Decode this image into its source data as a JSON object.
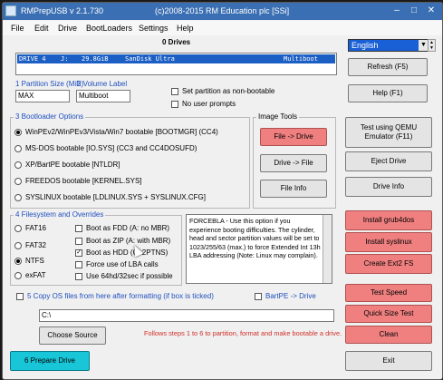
{
  "window": {
    "title": "RMPrepUSB v 2.1.730",
    "copyright": "(c)2008-2015 RM Education plc [SSi]",
    "controls": {
      "minimize": "–",
      "maximize": "□",
      "close": "✕"
    }
  },
  "menu": [
    "File",
    "Edit",
    "Drive",
    "BootLoaders",
    "Settings",
    "Help"
  ],
  "drives": {
    "title": "0 Drives",
    "row": {
      "drive": "DRIVE 4",
      "letter": "J:",
      "size": "29.8GiB",
      "name": "SanDisk Ultra",
      "type": "Multiboot"
    }
  },
  "language": {
    "selected": "English",
    "dropdown_icon": "▼"
  },
  "partition": {
    "size_label": "1 Partition Size (MiB)",
    "size_value": "MAX",
    "volume_label": "2 Volume Label",
    "volume_value": "Multiboot",
    "non_bootable": "Set partition as non-bootable",
    "no_prompts": "No user prompts"
  },
  "bootloader": {
    "title": "3 Bootloader Options",
    "options": [
      "WinPEv2/WinPEv3/Vista/Win7 bootable [BOOTMGR] (CC4)",
      "MS-DOS bootable [IO.SYS]   (CC3 and CC4DOSUFD)",
      "XP/BartPE bootable [NTLDR]",
      "FREEDOS bootable [KERNEL.SYS]",
      "SYSLINUX bootable [LDLINUX.SYS + SYSLINUX.CFG]"
    ]
  },
  "image_tools": {
    "title": "Image Tools",
    "file_to_drive": "File -> Drive",
    "drive_to_file": "Drive -> File",
    "file_info": "File Info"
  },
  "filesystem": {
    "title": "4 Filesystem and Overrides",
    "types": [
      "FAT16",
      "FAT32",
      "NTFS",
      "exFAT"
    ],
    "overrides": [
      "Boot as FDD (A: no MBR)",
      "Boot as ZIP (A: with MBR)",
      "Boot as HDD (C: 2PTNS)",
      "Force use of LBA calls",
      "Use 64hd/32sec if possible"
    ],
    "info_text": "FORCEBLA - Use this option if you experience booting difficulties. The cylinder, head and sector partition values will be set to 1023/255/63 (max.) to force Extended Int 13h LBA addressing (Note: Linux may complain)."
  },
  "copy_os": {
    "label": "5 Copy OS files from here after formatting (if box is ticked)",
    "bartpe": "BartPE -> Drive",
    "path_value": "C:\\",
    "choose_source": "Choose Source",
    "hint": "Follows steps 1 to 6 to partition, format and make bootable a drive."
  },
  "right_buttons": {
    "refresh": "Refresh (F5)",
    "help": "Help (F1)",
    "test_qemu": "Test using QEMU Emulator (F11)",
    "eject": "Eject Drive",
    "drive_info": "Drive Info",
    "install_grub4dos": "Install grub4dos",
    "install_syslinux": "Install syslinux",
    "create_ext2": "Create Ext2 FS",
    "test_speed": "Test Speed",
    "quick_size_test": "Quick Size Test",
    "clean": "Clean",
    "exit": "Exit"
  },
  "prepare": "6 Prepare Drive",
  "colors": {
    "accent_blue": "#1f4fbf",
    "red_button": "#f08080",
    "teal_button": "#19c6d8",
    "titlebar": "#3b6fb3"
  }
}
